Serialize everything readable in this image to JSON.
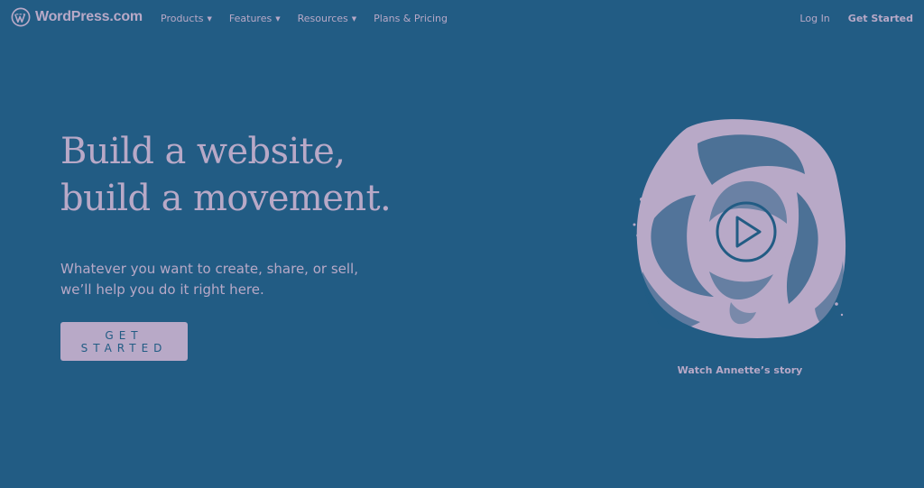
{
  "header": {
    "logo_text": "WordPress.com",
    "nav": [
      {
        "label": "Products",
        "has_dropdown": true
      },
      {
        "label": "Features",
        "has_dropdown": true
      },
      {
        "label": "Resources",
        "has_dropdown": true
      },
      {
        "label": "Plans & Pricing",
        "has_dropdown": false
      }
    ],
    "login_label": "Log In",
    "get_started_label": "Get Started"
  },
  "hero": {
    "title_line1": "Build a website,",
    "title_line2": "build a movement.",
    "subtitle_line1": "Whatever you want to create, share, or sell,",
    "subtitle_line2": "we’ll help you do it right here.",
    "cta_label": "GET STARTED"
  },
  "video": {
    "caption": "Watch Annette’s story",
    "play_icon": "play-icon"
  },
  "colors": {
    "background": "#225c84",
    "accent": "#b8a9c7"
  }
}
